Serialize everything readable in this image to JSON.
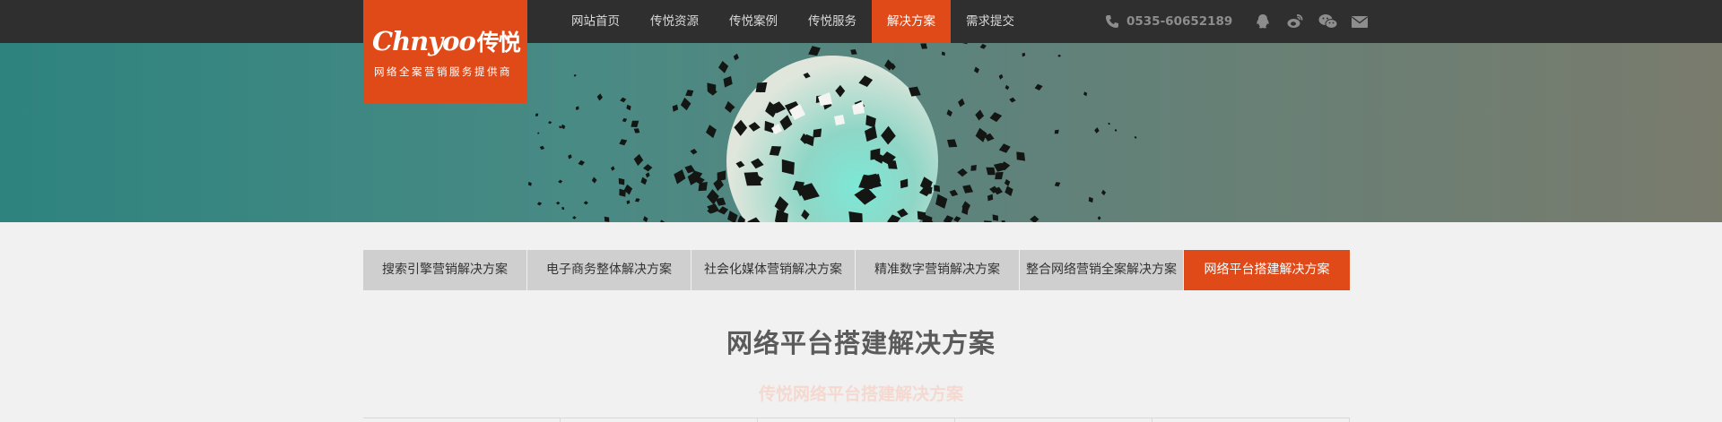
{
  "logo": {
    "mark": "Chnyoo",
    "mark_cn": "传悦",
    "tagline": "网络全案营销服务提供商"
  },
  "nav": {
    "items": [
      {
        "label": "网站首页"
      },
      {
        "label": "传悦资源"
      },
      {
        "label": "传悦案例"
      },
      {
        "label": "传悦服务"
      },
      {
        "label": "解决方案",
        "active": true
      },
      {
        "label": "需求提交"
      }
    ]
  },
  "contact": {
    "phone": "0535-60652189",
    "icons": [
      "qq-icon",
      "weibo-icon",
      "wechat-icon",
      "mail-icon"
    ]
  },
  "tabs": [
    {
      "label": "搜索引擎营销解决方案"
    },
    {
      "label": "电子商务整体解决方案"
    },
    {
      "label": "社会化媒体营销解决方案"
    },
    {
      "label": "精准数字营销解决方案"
    },
    {
      "label": "整合网络营销全案解决方案"
    },
    {
      "label": "网络平台搭建解决方案",
      "active": true
    }
  ],
  "main": {
    "title": "网络平台搭建解决方案",
    "subtitle": "传悦网络平台搭建解决方案"
  },
  "colors": {
    "accent": "#e04a19",
    "topbar": "#2f2f2f",
    "tab_bg": "#cfcfcf",
    "page_bg": "#f0f1f0"
  }
}
